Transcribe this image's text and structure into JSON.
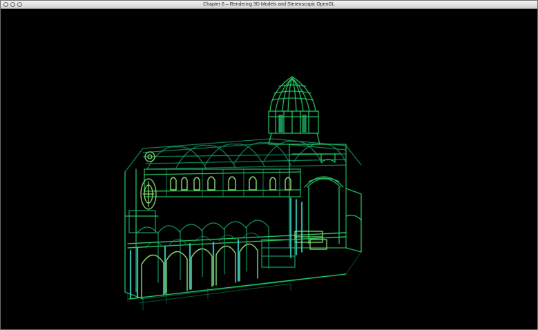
{
  "window": {
    "title": "Chapter 6 – Rendering 3D Models and Stereoscopic OpenGL",
    "controls": [
      "close",
      "minimize",
      "zoom"
    ]
  },
  "viewport": {
    "background": "#000000",
    "model": "cathedral-wireframe",
    "colors": {
      "primary": "#2bd56a",
      "secondary": "#1aa36a",
      "accent": "#3bd8c8",
      "highlight": "#9bef7a"
    }
  }
}
